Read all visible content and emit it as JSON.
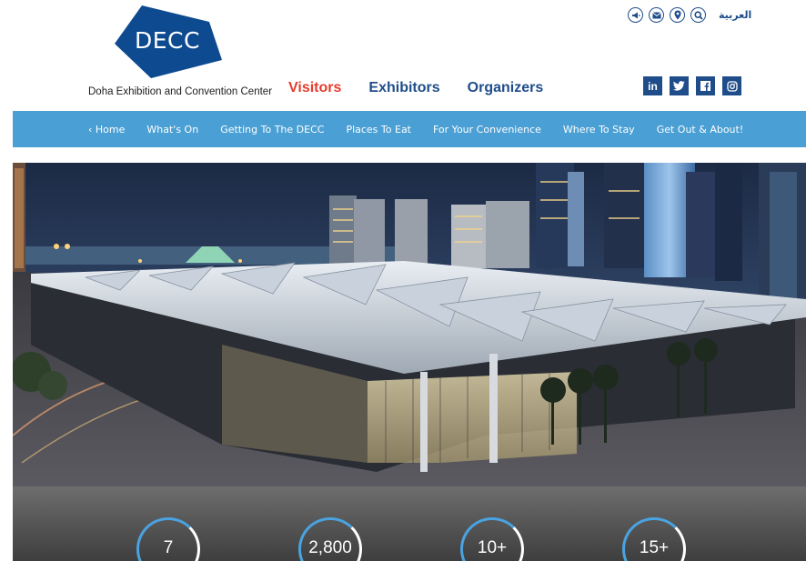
{
  "brand": {
    "logo_text": "DECC",
    "tagline": "Doha Exhibition and Convention Center",
    "color": "#0d4a90"
  },
  "main_nav": [
    {
      "label": "Visitors",
      "active": true
    },
    {
      "label": "Exhibitors",
      "active": false
    },
    {
      "label": "Organizers",
      "active": false
    }
  ],
  "utility": {
    "icons": [
      "megaphone-icon",
      "envelope-icon",
      "location-pin-icon",
      "search-icon"
    ],
    "language_label": "العربية"
  },
  "social": [
    "linkedin-icon",
    "twitter-icon",
    "facebook-icon",
    "instagram-icon"
  ],
  "social_glyphs": {
    "linkedin": "in"
  },
  "sub_nav": {
    "home_label": "‹ Home",
    "items": [
      "What's On",
      "Getting To The DECC",
      "Places To Eat",
      "For Your Convenience",
      "Where To Stay",
      "Get Out & About!"
    ]
  },
  "colors": {
    "nav_blue": "#1f4d8a",
    "active_red": "#e53d2c",
    "subnav_bg": "#4a9fd4",
    "stat_ring": "#4aa3e0"
  },
  "stats": [
    "7",
    "2,800",
    "10+",
    "15+"
  ]
}
